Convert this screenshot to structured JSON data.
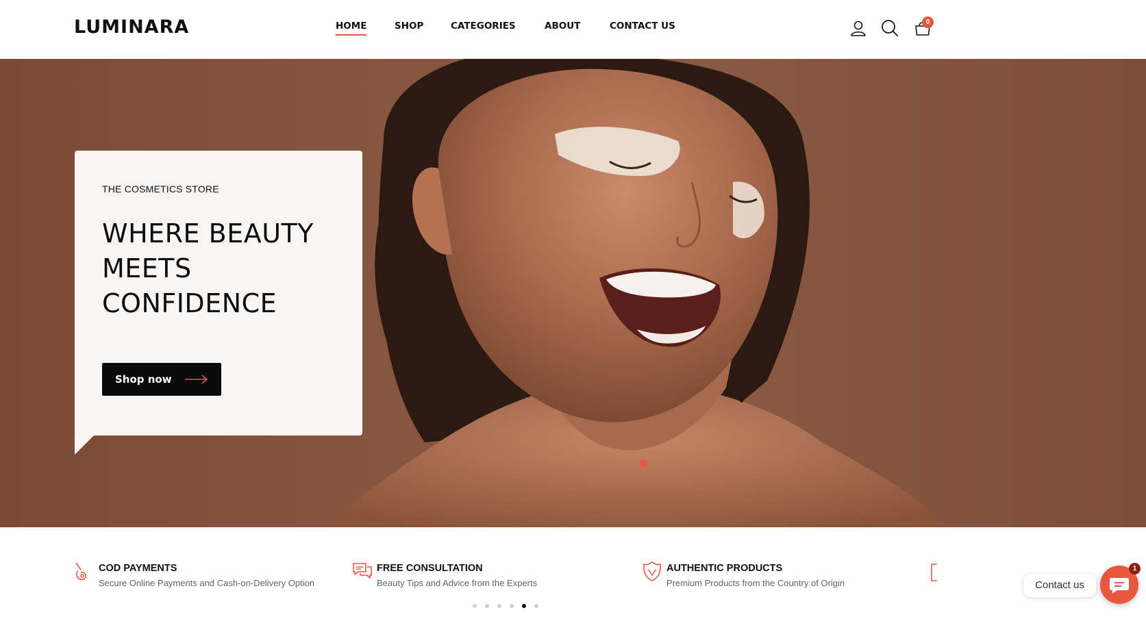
{
  "brand": {
    "logo": "LUMINARA",
    "accent": "#e8573f"
  },
  "nav": {
    "items": [
      {
        "label": "HOME",
        "active": true
      },
      {
        "label": "SHOP"
      },
      {
        "label": "CATEGORIES"
      },
      {
        "label": "ABOUT"
      },
      {
        "label": "CONTACT US"
      }
    ]
  },
  "header_icons": {
    "account": "user-icon",
    "search": "search-icon",
    "cart": "cart-icon",
    "cart_count": "0"
  },
  "hero": {
    "eyebrow": "THE COSMETICS STORE",
    "headline_lines": [
      "WHERE BEAUTY",
      "MEETS",
      "CONFIDENCE"
    ],
    "cta_label": "Shop now",
    "image": "smiling woman with eyes closed and white skincare cream on cheeks",
    "slide_indicator_color": "#e8573f"
  },
  "features": [
    {
      "icon": "payment-hand-icon",
      "title": "COD PAYMENTS",
      "desc": "Secure Online Payments and Cash-on-Delivery Option"
    },
    {
      "icon": "chat-bubbles-icon",
      "title": "FREE CONSULTATION",
      "desc": "Beauty Tips and Advice from the Experts"
    },
    {
      "icon": "shield-leaf-icon",
      "title": "AUTHENTIC PRODUCTS",
      "desc": "Premium Products from the Country of Origin"
    }
  ],
  "carousel_pager": {
    "total": 6,
    "active_index": 4
  },
  "chat_widget": {
    "label": "Contact us",
    "badge": "1",
    "icon": "chat-icon"
  }
}
